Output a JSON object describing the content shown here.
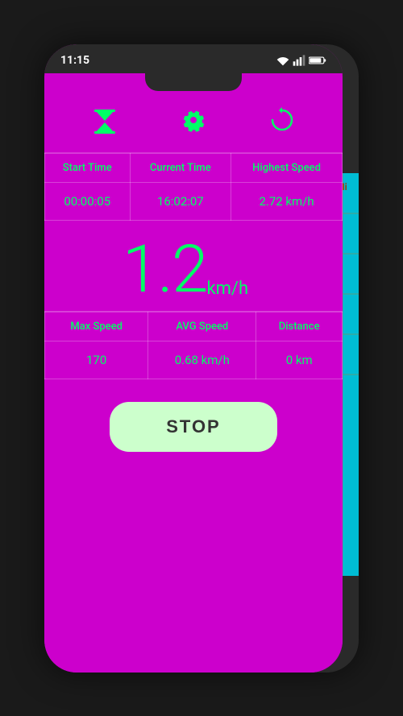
{
  "status": {
    "time": "11:15"
  },
  "toolbar": {
    "hourglass_label": "hourglass",
    "gear_label": "settings",
    "reset_label": "reset"
  },
  "table": {
    "headers": [
      "Start Time",
      "Current Time",
      "Highest Speed"
    ],
    "values": [
      "00:00:05",
      "16:02:07",
      "2.72 km/h"
    ]
  },
  "speed": {
    "value": "1.2",
    "unit": "km/h"
  },
  "bottom_table": {
    "headers": [
      "Max Speed",
      "AVG Speed",
      "Distance"
    ],
    "values": [
      "170",
      "0.68 km/h",
      "0 km"
    ]
  },
  "stop_button": {
    "label": "STOP"
  }
}
